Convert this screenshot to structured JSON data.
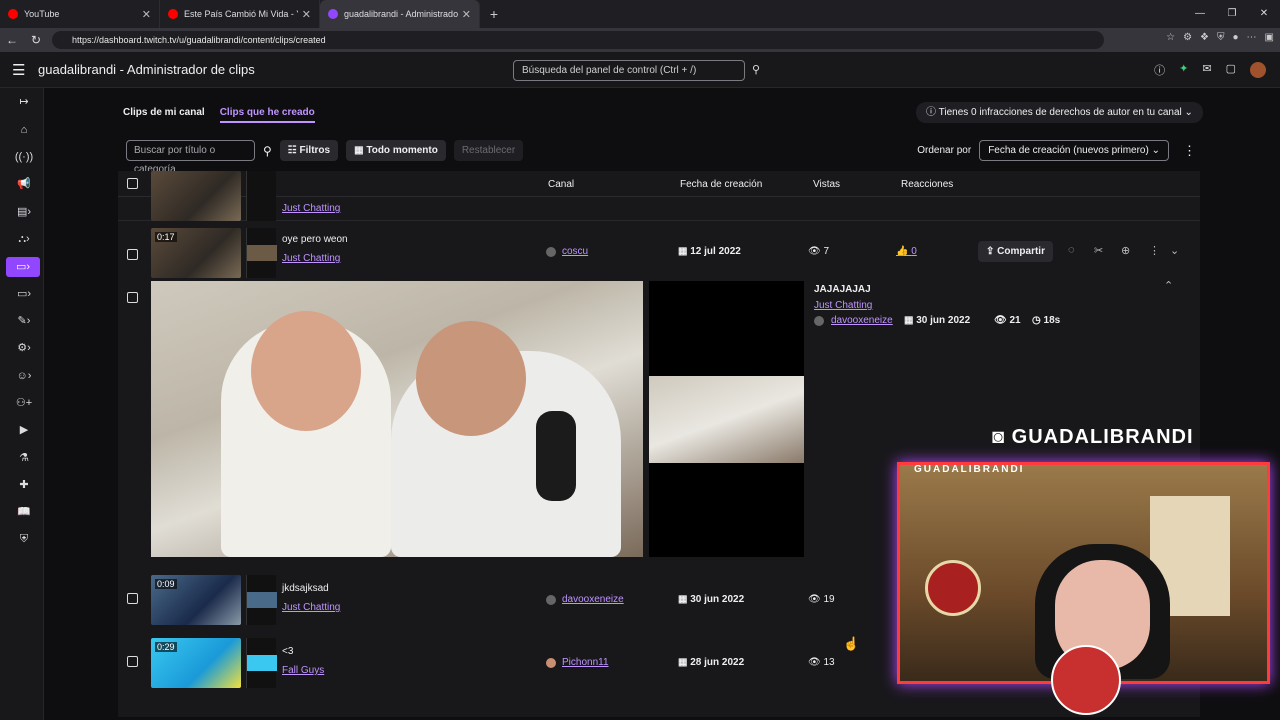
{
  "browser": {
    "tabs": [
      {
        "label": "YouTube",
        "fav_color": "#ff0000"
      },
      {
        "label": "Este País Cambió Mi Vida - YouTube",
        "fav_color": "#ff0000"
      },
      {
        "label": "guadalibrandi - Administrador",
        "fav_color": "#9147ff"
      }
    ],
    "url": "https://dashboard.twitch.tv/u/guadalibrandi/content/clips/created"
  },
  "topnav": {
    "title": "guadalibrandi - Administrador de clips",
    "search_placeholder": "Búsqueda del panel de control (Ctrl + /)"
  },
  "subtabs": {
    "mine": "Clips de mi canal",
    "created": "Clips que he creado"
  },
  "copyright_notice": "Tienes 0 infracciones de derechos de autor en tu canal",
  "filters": {
    "search_placeholder": "Buscar por título o categoría",
    "filters_label": "Filtros",
    "time_label": "Todo momento",
    "reset_label": "Restablecer",
    "sort_label": "Ordenar por",
    "sort_value": "Fecha de creación (nuevos primero)"
  },
  "table": {
    "headers": {
      "channel": "Canal",
      "created": "Fecha de creación",
      "views": "Vistas",
      "reactions": "Reacciones"
    },
    "partial_row": {
      "category": "Just Chatting"
    },
    "rows": [
      {
        "duration": "0:17",
        "title": "oye pero weon",
        "category": "Just Chatting",
        "channel": "coscu",
        "date": "12 jul 2022",
        "views": "7",
        "reactions": "0",
        "share": "Compartir"
      },
      {
        "duration": "0:09",
        "title": "jkdsajksad",
        "category": "Just Chatting",
        "channel": "davooxeneize",
        "date": "30 jun 2022",
        "views": "19"
      },
      {
        "duration": "0:29",
        "title": "<3",
        "category": "Fall Guys",
        "channel": "Pichonn11",
        "date": "28 jun 2022",
        "views": "13"
      }
    ],
    "expanded": {
      "title": "JAJAJAJAJ",
      "category": "Just Chatting",
      "channel": "davooxeneize",
      "date": "30 jun 2022",
      "views": "21",
      "length": "18s"
    }
  },
  "stream_overlay": {
    "brand": "GUADALIBRANDI",
    "frame_label": "GUADALIBRANDI"
  }
}
